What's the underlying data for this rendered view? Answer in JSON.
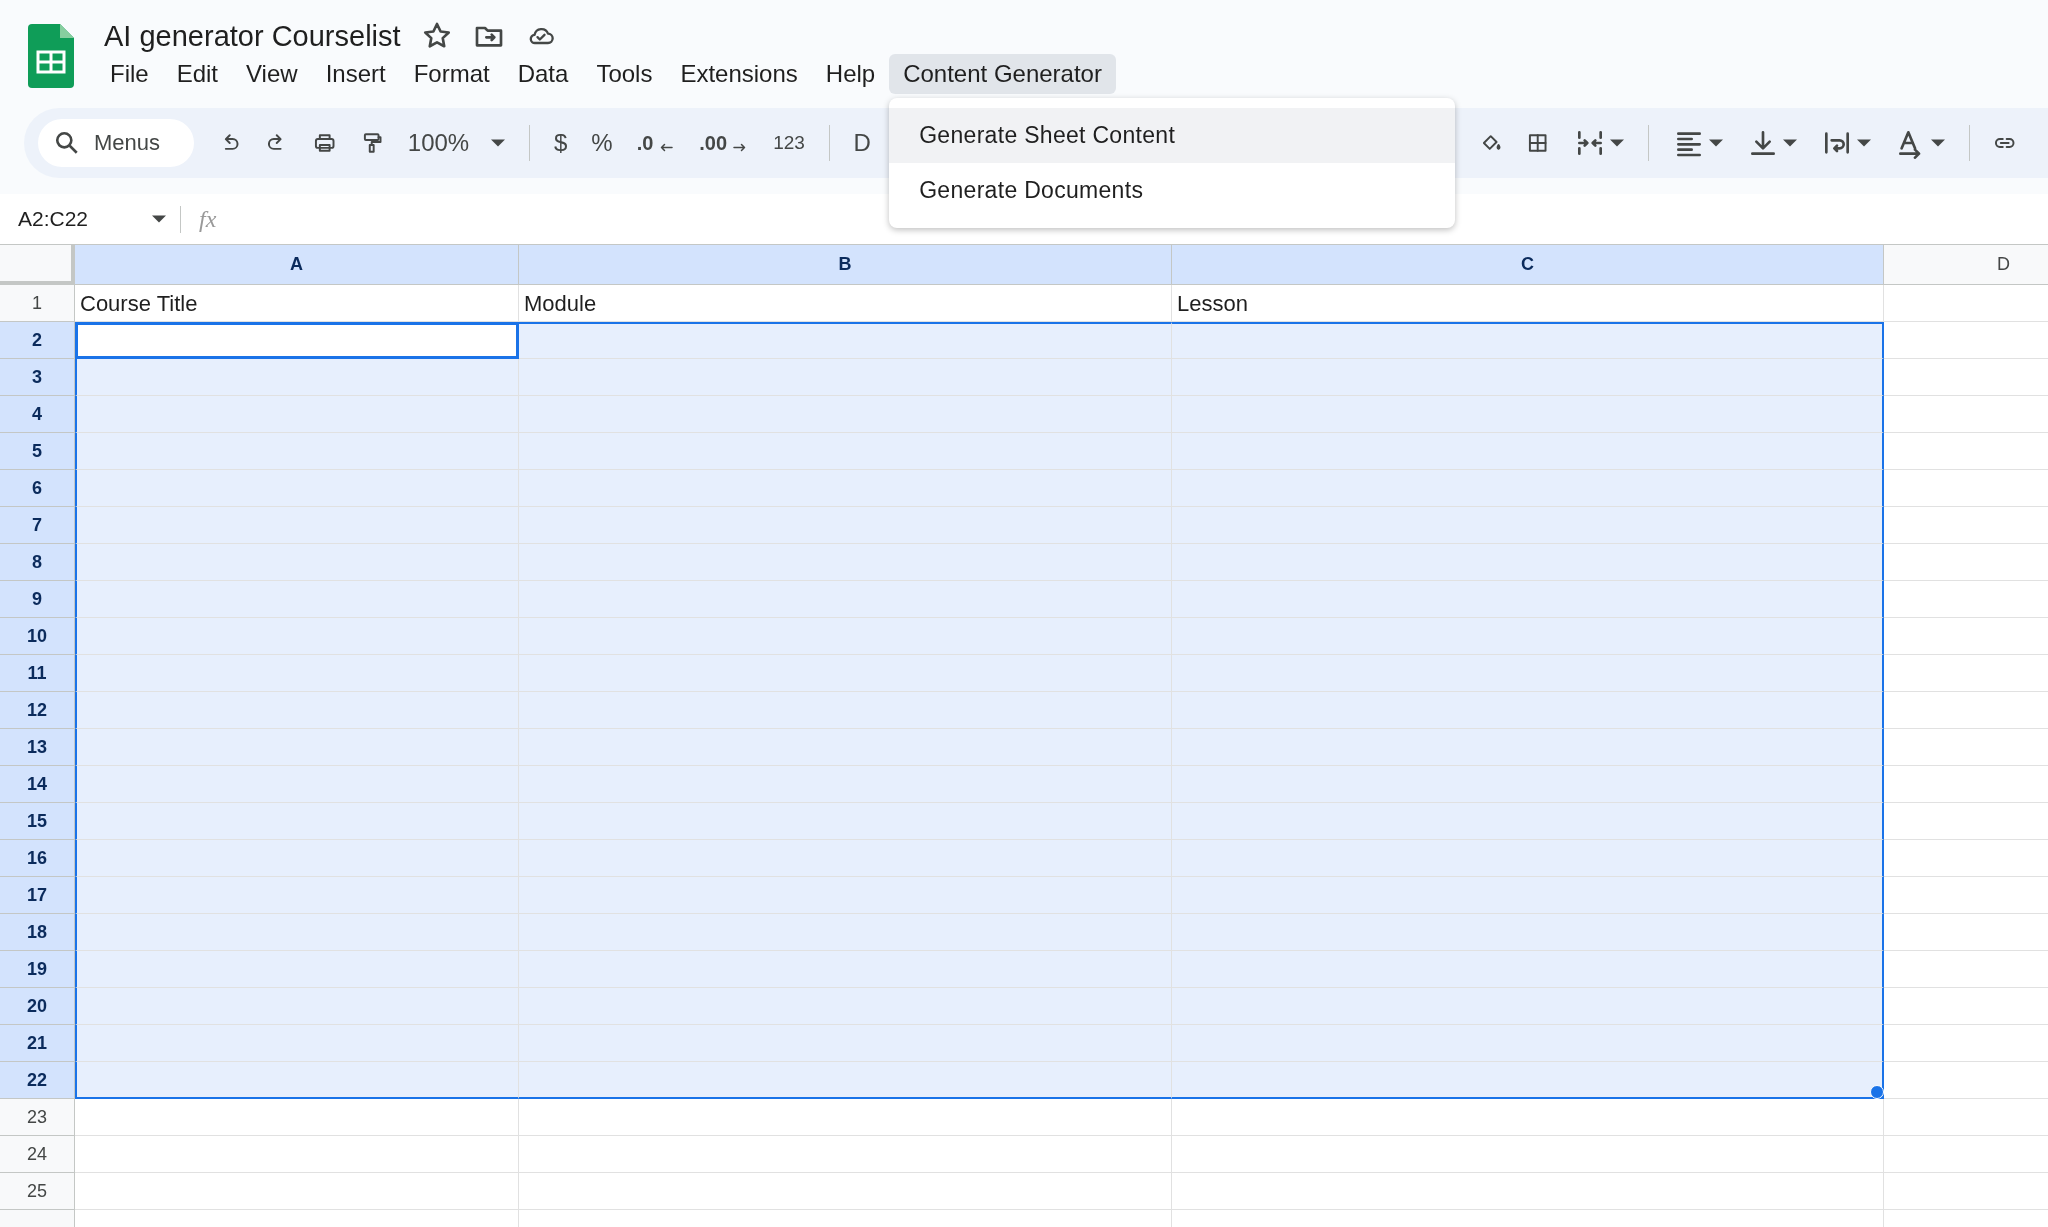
{
  "document": {
    "title": "AI generator Courselist"
  },
  "menus": [
    {
      "label": "File",
      "selected": false
    },
    {
      "label": "Edit",
      "selected": false
    },
    {
      "label": "View",
      "selected": false
    },
    {
      "label": "Insert",
      "selected": false
    },
    {
      "label": "Format",
      "selected": false
    },
    {
      "label": "Data",
      "selected": false
    },
    {
      "label": "Tools",
      "selected": false
    },
    {
      "label": "Extensions",
      "selected": false
    },
    {
      "label": "Help",
      "selected": false
    },
    {
      "label": "Content Generator",
      "selected": true
    }
  ],
  "dropdown": {
    "items": [
      {
        "label": "Generate Sheet Content",
        "hovered": true
      },
      {
        "label": "Generate Documents",
        "hovered": false
      }
    ]
  },
  "toolbar": {
    "search_placeholder": "Menus",
    "zoom": "100%",
    "currency": "$",
    "percent": "%",
    "decrease_decimal": ".0",
    "increase_decimal": ".00",
    "number_format": "123",
    "font": "D"
  },
  "formula_bar": {
    "name_box": "A2:C22",
    "fx": "fx"
  },
  "columns": [
    {
      "label": "A",
      "selected": true
    },
    {
      "label": "B",
      "selected": true
    },
    {
      "label": "C",
      "selected": true
    },
    {
      "label": "D",
      "selected": false
    }
  ],
  "rows": [
    {
      "label": "1",
      "selected": false,
      "active": false,
      "cells": [
        "Course Title",
        "Module",
        "Lesson"
      ]
    },
    {
      "label": "2",
      "selected": true,
      "active": true
    },
    {
      "label": "3",
      "selected": true,
      "active": false
    },
    {
      "label": "4",
      "selected": true,
      "active": false
    },
    {
      "label": "5",
      "selected": true,
      "active": false
    },
    {
      "label": "6",
      "selected": true,
      "active": false
    },
    {
      "label": "7",
      "selected": true,
      "active": false
    },
    {
      "label": "8",
      "selected": true,
      "active": false
    },
    {
      "label": "9",
      "selected": true,
      "active": false
    },
    {
      "label": "10",
      "selected": true,
      "active": false
    },
    {
      "label": "11",
      "selected": true,
      "active": false
    },
    {
      "label": "12",
      "selected": true,
      "active": false
    },
    {
      "label": "13",
      "selected": true,
      "active": false
    },
    {
      "label": "14",
      "selected": true,
      "active": false
    },
    {
      "label": "15",
      "selected": true,
      "active": false
    },
    {
      "label": "16",
      "selected": true,
      "active": false
    },
    {
      "label": "17",
      "selected": true,
      "active": false
    },
    {
      "label": "18",
      "selected": true,
      "active": false
    },
    {
      "label": "19",
      "selected": true,
      "active": false
    },
    {
      "label": "20",
      "selected": true,
      "active": false
    },
    {
      "label": "21",
      "selected": true,
      "active": false
    },
    {
      "label": "22",
      "selected": true,
      "active": false
    },
    {
      "label": "23",
      "selected": false,
      "active": false
    },
    {
      "label": "24",
      "selected": false,
      "active": false
    },
    {
      "label": "25",
      "selected": false,
      "active": false
    }
  ]
}
